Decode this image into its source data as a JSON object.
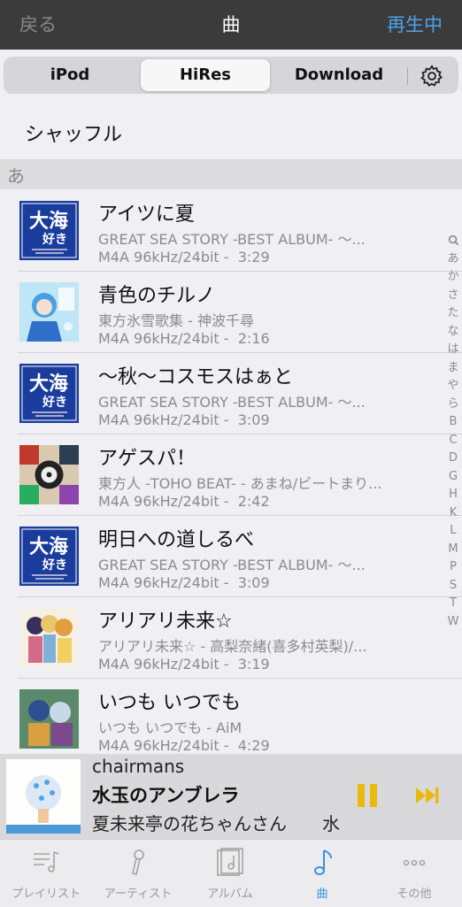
{
  "nav": {
    "back_label": "戻る",
    "title": "曲",
    "now_playing_label": "再生中"
  },
  "segments": {
    "ipod": "iPod",
    "hires": "HiRes",
    "download": "Download",
    "selected": "HiRes"
  },
  "icons": {
    "settings": "gear-icon"
  },
  "shuffle_label": "シャッフル",
  "section_header": "あ",
  "songs": [
    {
      "title": "アイツに夏",
      "subtitle": "GREAT SEA STORY -BEST ALBUM- 〜...",
      "format": "M4A 96kHz/24bit -",
      "duration": "3:29",
      "art": "sea-story"
    },
    {
      "title": "青色のチルノ",
      "subtitle": "東方氷雪歌集 - 神波千尋",
      "format": "M4A 96kHz/24bit -",
      "duration": "2:16",
      "art": "cirno"
    },
    {
      "title": "〜秋〜コスモスはぁと",
      "subtitle": "GREAT SEA STORY -BEST ALBUM- 〜...",
      "format": "M4A 96kHz/24bit -",
      "duration": "3:09",
      "art": "sea-story"
    },
    {
      "title": "アゲスパ！",
      "subtitle": "東方人 -TOHO BEAT- - あまね/ビートまり...",
      "format": "M4A 96kHz/24bit -",
      "duration": "2:42",
      "art": "toho-beat"
    },
    {
      "title": "明日への道しるべ",
      "subtitle": "GREAT SEA STORY -BEST ALBUM- 〜...",
      "format": "M4A 96kHz/24bit -",
      "duration": "3:09",
      "art": "sea-story"
    },
    {
      "title": "アリアリ未来☆",
      "subtitle": "アリアリ未来☆ - 高梨奈緒(喜多村英梨)/...",
      "format": "M4A 96kHz/24bit -",
      "duration": "3:19",
      "art": "ariari"
    },
    {
      "title": "いつも いつでも",
      "subtitle": "いつも いつでも - AiM",
      "format": "M4A 96kHz/24bit -",
      "duration": "4:29",
      "art": "itsumo"
    }
  ],
  "index_letters": [
    "Q",
    "あ",
    "か",
    "さ",
    "た",
    "な",
    "は",
    "ま",
    "や",
    "ら",
    "B",
    "C",
    "D",
    "G",
    "H",
    "K",
    "L",
    "M",
    "P",
    "S",
    "T",
    "W"
  ],
  "mini_player": {
    "artist": "chairmans",
    "track": "水玉のアンブレラ",
    "album": "夏未来亭の花ちゃんさん　　水",
    "accent_color": "#e9b90e"
  },
  "tabs": [
    {
      "label": "プレイリスト",
      "icon": "playlist-icon",
      "active": false
    },
    {
      "label": "アーティスト",
      "icon": "artist-icon",
      "active": false
    },
    {
      "label": "アルバム",
      "icon": "album-icon",
      "active": false
    },
    {
      "label": "曲",
      "icon": "song-icon",
      "active": true
    },
    {
      "label": "その他",
      "icon": "more-icon",
      "active": false
    }
  ],
  "colors": {
    "accent": "#3a8fe8",
    "navbar": "#3b3b3b",
    "pause": "#e9b90e"
  }
}
